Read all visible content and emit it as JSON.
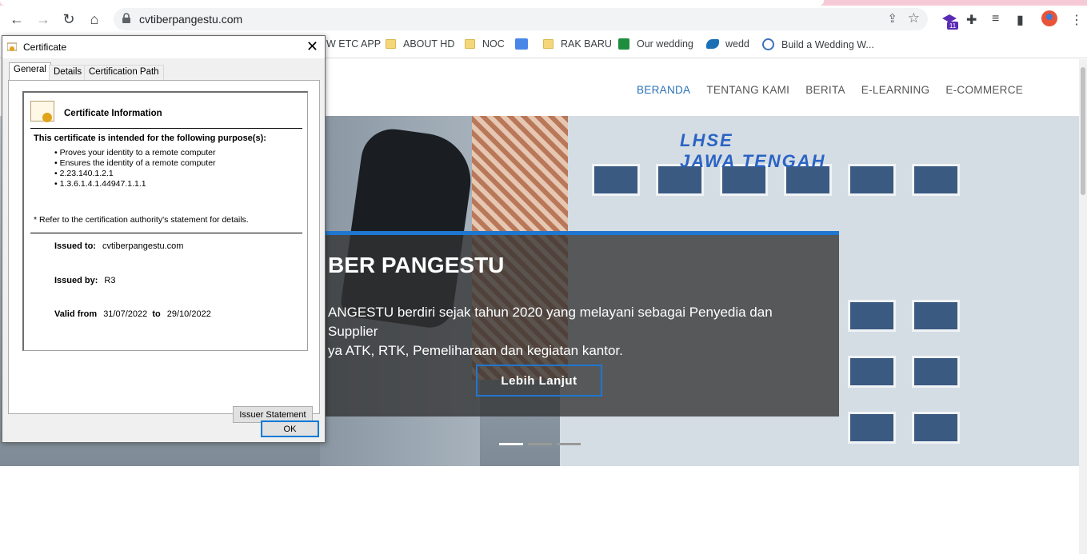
{
  "browser": {
    "url": "cvtiberpangestu.com",
    "icons": [
      "back-icon",
      "forward-icon",
      "reload-icon",
      "home-icon",
      "lock-icon",
      "share-icon",
      "star-icon",
      "extension-icon",
      "puzzle-icon",
      "media-icon",
      "sidepanel-icon",
      "profile-icon",
      "menu-icon"
    ],
    "extension_badge": "11"
  },
  "bookmarks": [
    {
      "label": "W ETC APP",
      "icon": "none"
    },
    {
      "label": "ABOUT HD",
      "icon": "folder"
    },
    {
      "label": "NOC",
      "icon": "folder"
    },
    {
      "label": "",
      "icon": "translate"
    },
    {
      "label": "RAK BARU",
      "icon": "folder"
    },
    {
      "label": "Our wedding",
      "icon": "sheets"
    },
    {
      "label": "wedd",
      "icon": "drive"
    },
    {
      "label": "Build a Wedding W...",
      "icon": "wordpress"
    }
  ],
  "site": {
    "nav": [
      "BERANDA",
      "TENTANG KAMI",
      "BERITA",
      "E-LEARNING",
      "E-COMMERCE"
    ],
    "hero_sign_1": "LHSE",
    "hero_sign_2": "JAWA TENGAH",
    "hero_title": "BER PANGESTU",
    "hero_desc_1": "ANGESTU berdiri sejak tahun 2020 yang melayani sebagai Penyedia dan Supplier",
    "hero_desc_2": "ya ATK, RTK, Pemeliharaan dan kegiatan kantor.",
    "hero_button": "Lebih Lanjut",
    "accent_color": "#1f77d0"
  },
  "dialog": {
    "title": "Certificate",
    "tabs": [
      "General",
      "Details",
      "Certification Path"
    ],
    "info_header": "Certificate Information",
    "purpose_heading": "This certificate is intended for the following purpose(s):",
    "purposes": [
      "Proves your identity to a remote computer",
      "Ensures the identity of a remote computer",
      "2.23.140.1.2.1",
      "1.3.6.1.4.1.44947.1.1.1"
    ],
    "note": "* Refer to the certification authority's statement for details.",
    "issued_to_label": "Issued to:",
    "issued_to": "cvtiberpangestu.com",
    "issued_by_label": "Issued by:",
    "issued_by": "R3",
    "valid_from_label": "Valid from",
    "valid_from": "31/07/2022",
    "valid_to_label": "to",
    "valid_to": "29/10/2022",
    "issuer_button": "Issuer Statement",
    "ok_button": "OK"
  }
}
